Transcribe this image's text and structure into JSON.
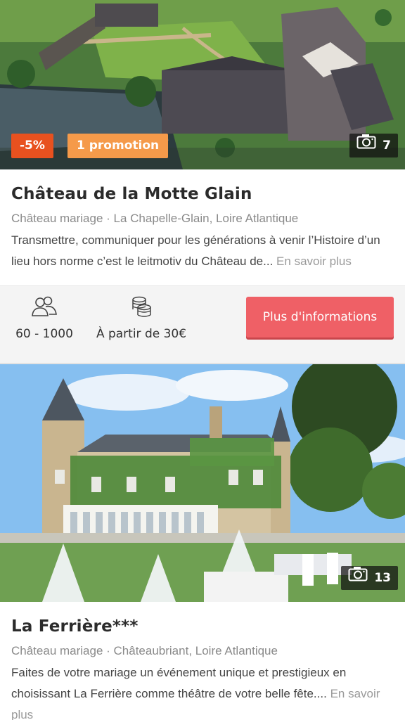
{
  "listings": [
    {
      "discount_badge": "-5%",
      "promotion_badge": "1 promotion",
      "photo_count": "7",
      "title": "Château de la Motte Glain",
      "category": "Château mariage · La Chapelle-Glain, Loire Atlantique",
      "description": "Transmettre, communiquer pour les générations à venir l’Histoire d’un lieu hors norme c’est le leitmotiv du Château de...",
      "more_link": "En savoir plus",
      "guests": "60 - 1000",
      "price": "À partir de 30€",
      "cta_label": "Plus d'informations",
      "guests_icon": "people-icon",
      "price_icon": "coins-icon",
      "camera_icon": "camera-icon"
    },
    {
      "photo_count": "13",
      "title": "La Ferrière***",
      "category": "Château mariage · Châteaubriant, Loire Atlantique",
      "description": "Faites de votre mariage un événement unique et prestigieux en choisissant La Ferrière comme théâtre de votre belle fête....",
      "more_link": "En savoir plus",
      "camera_icon": "camera-icon"
    }
  ],
  "colors": {
    "discount": "#e8511f",
    "promotion": "#f59a4a",
    "cta": "#ef6066"
  }
}
